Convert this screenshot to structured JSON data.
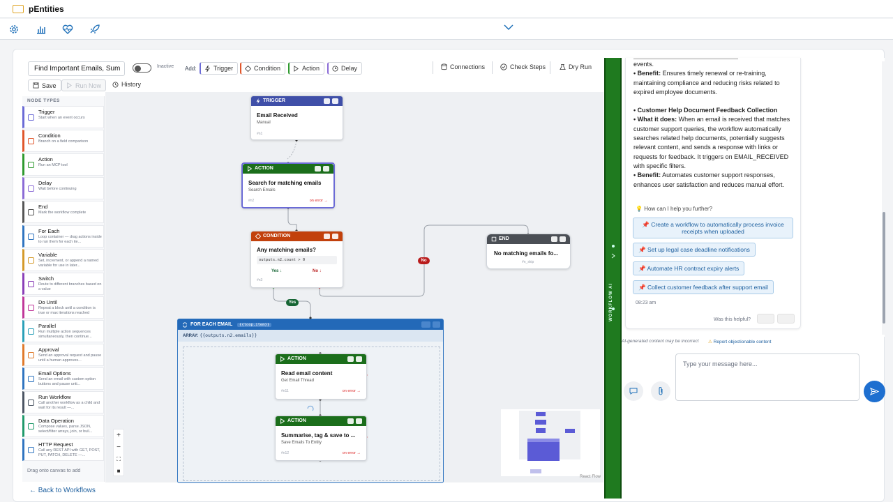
{
  "app": {
    "title": "pEntities"
  },
  "toolbar": {
    "workflow_name": "Find Important Emails, Sum",
    "status": "Inactive",
    "add_label": "Add:",
    "add_buttons": [
      "Trigger",
      "Condition",
      "Action",
      "Delay"
    ],
    "connections": "Connections",
    "check_steps": "Check Steps",
    "dry_run": "Dry Run",
    "save": "Save",
    "run_now": "Run Now",
    "history": "History"
  },
  "palette": {
    "header": "NODE TYPES",
    "items": [
      {
        "title": "Trigger",
        "desc": "Start when an event occurs",
        "color": "#6b6bd6"
      },
      {
        "title": "Condition",
        "desc": "Branch on a field comparison",
        "color": "#e0562b"
      },
      {
        "title": "Action",
        "desc": "Run an MCP tool",
        "color": "#2f9a2f"
      },
      {
        "title": "Delay",
        "desc": "Wait before continuing",
        "color": "#8b6bd6"
      },
      {
        "title": "End",
        "desc": "Mark the workflow complete",
        "color": "#555555"
      },
      {
        "title": "For Each",
        "desc": "Loop container — drag actions inside to run them for each ite...",
        "color": "#2f74c0"
      },
      {
        "title": "Variable",
        "desc": "Set, increment, or append a named variable for use in later...",
        "color": "#d49a2a"
      },
      {
        "title": "Switch",
        "desc": "Route to different branches based on a value",
        "color": "#8a3fb8"
      },
      {
        "title": "Do Until",
        "desc": "Repeat a block until a condition is true or max iterations reached",
        "color": "#c0379a"
      },
      {
        "title": "Parallel",
        "desc": "Run multiple action sequences simultaneously, then continue...",
        "color": "#2aa0b8"
      },
      {
        "title": "Approval",
        "desc": "Send an approval request and pause until a human approves...",
        "color": "#e07a2b"
      },
      {
        "title": "Email Options",
        "desc": "Send an email with custom option buttons and pause unti...",
        "color": "#2f74c0"
      },
      {
        "title": "Run Workflow",
        "desc": "Call another workflow as a child and wait for its result —...",
        "color": "#4b5563"
      },
      {
        "title": "Data Operation",
        "desc": "Compose values, parse JSON, select/filter arrays, join, or buil...",
        "color": "#1f9a6b"
      },
      {
        "title": "HTTP Request",
        "desc": "Call any REST API with GET, POST, PUT, PATCH, DELETE —...",
        "color": "#2f74c0"
      }
    ],
    "drag_note": "Drag onto canvas to add"
  },
  "nodes": {
    "trigger": {
      "type": "TRIGGER",
      "title": "Email Received",
      "sub": "Manual",
      "id": "#n1"
    },
    "action1": {
      "type": "ACTION",
      "title": "Search for matching emails",
      "sub": "Search Emails",
      "id": "#n2",
      "err": "on error →"
    },
    "condition": {
      "type": "CONDITION",
      "title": "Any matching emails?",
      "expr": "outputs.n2.count > 0",
      "yes": "Yes ↓",
      "no": "No ↓",
      "id": "#n3"
    },
    "end": {
      "type": "END",
      "title": "No matching emails fo...",
      "id": "#n_skip"
    },
    "foreach": {
      "type": "FOR EACH EMAIL",
      "tag": "{{loop.item}}",
      "array_label": "ARRAY:",
      "array": "{{outputs.n2.emails}}"
    },
    "action2": {
      "type": "ACTION",
      "title": "Read email content",
      "sub": "Get Email Thread",
      "id": "#n11",
      "err": "on error →"
    },
    "action3": {
      "type": "ACTION",
      "title": "Summarise, tag & save to ...",
      "sub": "Save Emails To Entity",
      "id": "#n12",
      "err": "on error →"
    },
    "pill_no": "No",
    "pill_yes": "Yes"
  },
  "canvas": {
    "react_flow": "React Flow"
  },
  "ai": {
    "strip_label": "WORKFLOW AI",
    "msg": {
      "l0": "events.",
      "l1b": "• Benefit:",
      "l1": " Ensures timely renewal or re-training, maintaining compliance and reducing risks related to expired employee documents.",
      "h2": "• Customer Help Document Feedback Collection",
      "l2b": "• What it does:",
      "l2": " When an email is received that matches customer support queries, the workflow automatically searches related help documents, potentially suggests relevant content, and sends a response with links or requests for feedback. It triggers on EMAIL_RECEIVED with specific filters.",
      "l3b": "• Benefit:",
      "l3": " Automates customer support responses, enhances user satisfaction and reduces manual effort."
    },
    "help_prompt": "How can I help you further?",
    "suggestions": [
      "Create a workflow to automatically process invoice receipts when uploaded",
      "Set up legal case deadline notifications",
      "Automate HR contract expiry alerts",
      "Collect customer feedback after support email"
    ],
    "timestamp": "08:23 am",
    "helpful": "Was this helpful?",
    "disclaimer": "AI-generated content may be incorrect",
    "report": "Report objectionable content",
    "input_placeholder": "Type your message here..."
  },
  "footer": {
    "back": "← Back to Workflows"
  }
}
